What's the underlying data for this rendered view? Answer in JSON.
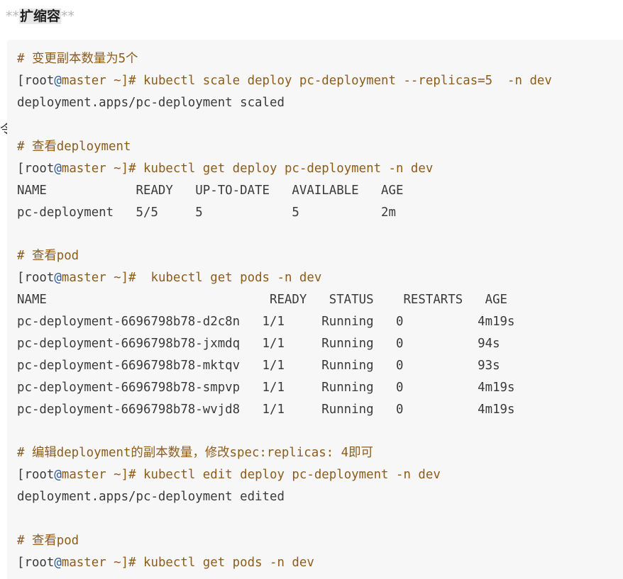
{
  "heading": {
    "prefix": "**",
    "text": "扩缩容",
    "suffix": "**"
  },
  "side_mark": "令",
  "code": {
    "comment_scale": "# 变更副本数量为5个",
    "prompt_user_1": "[root",
    "prompt_at_1": "@",
    "prompt_rest_1": "master ~]# kubectl scale deploy pc-deployment --replicas=5  -n dev",
    "output_scale": "deployment.apps/pc-deployment scaled",
    "comment_view_deploy": "# 查看deployment",
    "prompt_user_2": "[root",
    "prompt_at_2": "@",
    "prompt_rest_2": "master ~]# kubectl get deploy pc-deployment -n dev",
    "deploy_header": "NAME            READY   UP-TO-DATE   AVAILABLE   AGE",
    "deploy_row": "pc-deployment   5/5     5            5           2m",
    "comment_view_pod_1": "# 查看pod",
    "prompt_user_3": "[root",
    "prompt_at_3": "@",
    "prompt_rest_3": "master ~]#  kubectl get pods -n dev",
    "pods_header": "NAME                              READY   STATUS    RESTARTS   AGE",
    "pods_rows": [
      "pc-deployment-6696798b78-d2c8n   1/1     Running   0          4m19s",
      "pc-deployment-6696798b78-jxmdq   1/1     Running   0          94s",
      "pc-deployment-6696798b78-mktqv   1/1     Running   0          93s",
      "pc-deployment-6696798b78-smpvp   1/1     Running   0          4m19s",
      "pc-deployment-6696798b78-wvjd8   1/1     Running   0          4m19s"
    ],
    "comment_edit": "# 编辑deployment的副本数量，修改spec:replicas: 4即可",
    "prompt_user_4": "[root",
    "prompt_at_4": "@",
    "prompt_rest_4": "master ~]# kubectl edit deploy pc-deployment -n dev",
    "output_edit": "deployment.apps/pc-deployment edited",
    "comment_view_pod_2": "# 查看pod",
    "prompt_user_5": "[root",
    "prompt_at_5": "@",
    "prompt_rest_5": "master ~]# kubectl get pods -n dev"
  }
}
